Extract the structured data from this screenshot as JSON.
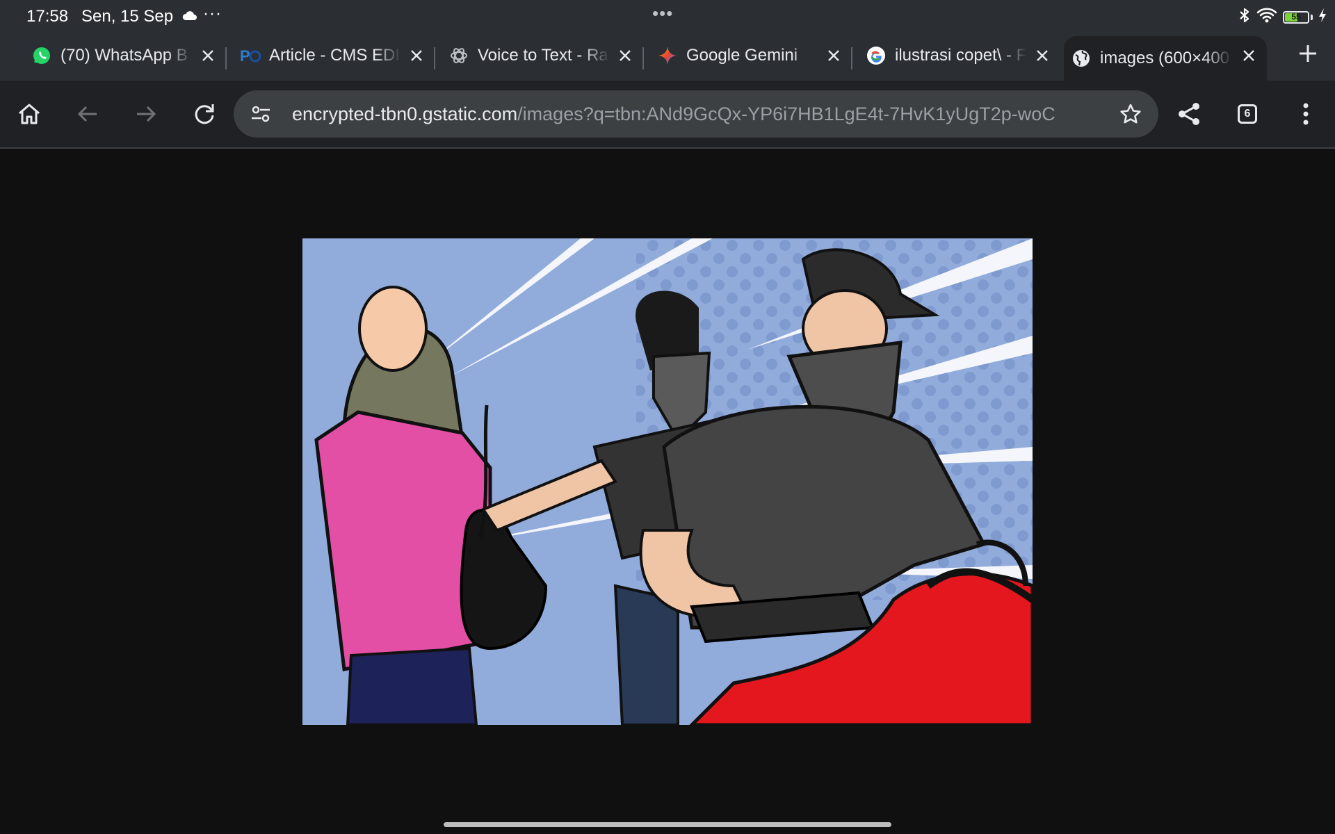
{
  "status_bar": {
    "time": "17:58",
    "date": "Sen, 15 Sep",
    "more": "···",
    "center_handle": "•••",
    "battery_level": "55",
    "battery_fraction": 0.55
  },
  "tabs": [
    {
      "title": "(70) WhatsApp B",
      "favicon": "whatsapp-icon",
      "active": false
    },
    {
      "title": "Article - CMS EDI",
      "favicon": "cms-po-icon",
      "active": false
    },
    {
      "title": "Voice to Text - Ra",
      "favicon": "openai-icon",
      "active": false
    },
    {
      "title": "Google Gemini",
      "favicon": "gemini-icon",
      "active": false
    },
    {
      "title": "ilustrasi copet\\ - F",
      "favicon": "google-icon",
      "active": false
    },
    {
      "title": "images (600×400",
      "favicon": "globe-icon",
      "active": true
    }
  ],
  "toolbar": {
    "url_host": "encrypted-tbn0.gstatic.com",
    "url_path": "/images?q=tbn:ANd9GcQx-YP6i7HB1LgE4t-7HvK1yUgT2p-woC",
    "tab_count": "6"
  },
  "colors": {
    "chrome_bg": "#2b2f34",
    "toolbar_bg": "#202124",
    "page_bg": "#101010",
    "omnibox_bg": "#3c4043",
    "illustration_blue": "#8fa9d9",
    "jacket_pink": "#e44fa6",
    "scarf_olive": "#75785f",
    "motorcycle_red": "#e3171d"
  }
}
